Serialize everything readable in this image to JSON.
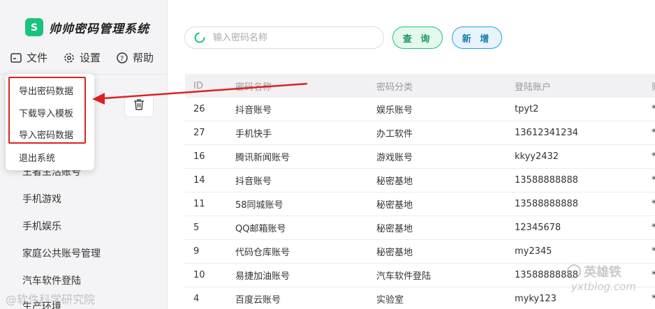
{
  "app": {
    "title": "帅帅密码管理系统"
  },
  "menubar": [
    {
      "label": "文件",
      "icon": "file-icon"
    },
    {
      "label": "设置",
      "icon": "gear-icon"
    },
    {
      "label": "帮助",
      "icon": "help-icon"
    }
  ],
  "file_menu": {
    "items": [
      "导出密码数据",
      "下载导入模板",
      "导入密码数据",
      "退出系统"
    ]
  },
  "sidebar": {
    "categories": [
      "王者生活账号",
      "手机游戏",
      "手机娱乐",
      "家庭公共账号管理",
      "汽车软件登陆",
      "生产环境"
    ]
  },
  "search": {
    "placeholder": "输入密码名称",
    "value": ""
  },
  "buttons": {
    "query": "查 询",
    "add": "新 增"
  },
  "table": {
    "headers": [
      "ID",
      "密码名称",
      "密码分类",
      "登陆账户",
      "则"
    ],
    "rows": [
      {
        "id": "26",
        "name": "抖音账号",
        "category": "娱乐账号",
        "account": "tpyt2",
        "extra": "*"
      },
      {
        "id": "27",
        "name": "手机快手",
        "category": "办工软件",
        "account": "13612341234",
        "extra": "*"
      },
      {
        "id": "16",
        "name": "腾讯新闻账号",
        "category": "游戏账号",
        "account": "kkyy2432",
        "extra": "*"
      },
      {
        "id": "14",
        "name": "抖音账号",
        "category": "秘密基地",
        "account": "13588888888",
        "extra": "*"
      },
      {
        "id": "11",
        "name": "58同城账号",
        "category": "秘密基地",
        "account": "13588888888",
        "extra": "*"
      },
      {
        "id": "5",
        "name": "QQ邮箱账号",
        "category": "秘密基地",
        "account": "12345678",
        "extra": "*"
      },
      {
        "id": "9",
        "name": "代码仓库账号",
        "category": "秘密基地",
        "account": "my2345",
        "extra": "*"
      },
      {
        "id": "10",
        "name": "易捷加油账号",
        "category": "汽车软件登陆",
        "account": "13588888888",
        "extra": "*"
      },
      {
        "id": "4",
        "name": "百度云账号",
        "category": "实验室",
        "account": "myky123",
        "extra": "*"
      }
    ]
  },
  "watermarks": {
    "left": "@软件科学研究院",
    "right_title": "英雄铁",
    "right_site": "yxtblog.com"
  },
  "colors": {
    "brand": "#19c37d",
    "query_btn": "#19c37d",
    "add_btn": "#1ea6d8",
    "highlight": "#e02020"
  }
}
